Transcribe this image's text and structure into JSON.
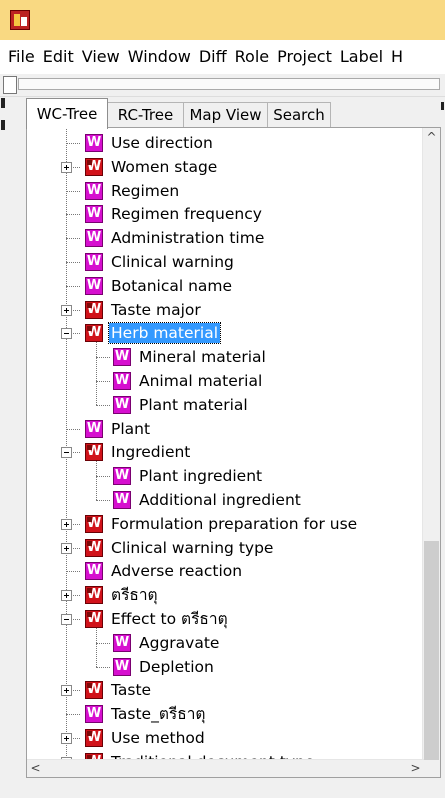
{
  "menu": [
    "File",
    "Edit",
    "View",
    "Window",
    "Diff",
    "Role",
    "Project",
    "Label",
    "H"
  ],
  "tabs": [
    {
      "label": "WC-Tree",
      "active": true
    },
    {
      "label": "RC-Tree",
      "active": false
    },
    {
      "label": "Map View",
      "active": false
    },
    {
      "label": "Search",
      "active": false
    }
  ],
  "tree": {
    "nodes": [
      {
        "label": "Use direction",
        "depth": 0,
        "icon": "pink",
        "expander": "none"
      },
      {
        "label": "Women stage",
        "depth": 0,
        "icon": "red",
        "expander": "plus"
      },
      {
        "label": "Regimen",
        "depth": 0,
        "icon": "pink",
        "expander": "none"
      },
      {
        "label": "Regimen frequency",
        "depth": 0,
        "icon": "pink",
        "expander": "none"
      },
      {
        "label": "Administration time",
        "depth": 0,
        "icon": "pink",
        "expander": "none"
      },
      {
        "label": "Clinical warning",
        "depth": 0,
        "icon": "pink",
        "expander": "none"
      },
      {
        "label": "Botanical name",
        "depth": 0,
        "icon": "pink",
        "expander": "none"
      },
      {
        "label": "Taste major",
        "depth": 0,
        "icon": "red",
        "expander": "plus"
      },
      {
        "label": "Herb material",
        "depth": 0,
        "icon": "red",
        "expander": "minus",
        "selected": true
      },
      {
        "label": "Mineral material",
        "depth": 1,
        "icon": "pink",
        "expander": "none"
      },
      {
        "label": "Animal material",
        "depth": 1,
        "icon": "pink",
        "expander": "none"
      },
      {
        "label": "Plant material",
        "depth": 1,
        "icon": "pink",
        "expander": "none"
      },
      {
        "label": "Plant",
        "depth": 0,
        "icon": "pink",
        "expander": "none"
      },
      {
        "label": "Ingredient",
        "depth": 0,
        "icon": "red",
        "expander": "minus"
      },
      {
        "label": "Plant ingredient",
        "depth": 1,
        "icon": "pink",
        "expander": "none"
      },
      {
        "label": "Additional ingredient",
        "depth": 1,
        "icon": "pink",
        "expander": "none"
      },
      {
        "label": "Formulation preparation for use",
        "depth": 0,
        "icon": "red",
        "expander": "plus"
      },
      {
        "label": "Clinical warning type",
        "depth": 0,
        "icon": "red",
        "expander": "plus"
      },
      {
        "label": "Adverse reaction",
        "depth": 0,
        "icon": "pink",
        "expander": "none"
      },
      {
        "label": "ตรีธาตุ",
        "depth": 0,
        "icon": "red",
        "expander": "plus"
      },
      {
        "label": "Effect to ตรีธาตุ",
        "depth": 0,
        "icon": "red",
        "expander": "minus"
      },
      {
        "label": "Aggravate",
        "depth": 1,
        "icon": "pink",
        "expander": "none"
      },
      {
        "label": "Depletion",
        "depth": 1,
        "icon": "pink",
        "expander": "none"
      },
      {
        "label": "Taste",
        "depth": 0,
        "icon": "red",
        "expander": "plus"
      },
      {
        "label": "Taste_ตรีธาตุ",
        "depth": 0,
        "icon": "pink",
        "expander": "none"
      },
      {
        "label": "Use method",
        "depth": 0,
        "icon": "red",
        "expander": "plus"
      },
      {
        "label": "Traditional document type",
        "depth": 0,
        "icon": "red",
        "expander": "plus"
      }
    ]
  },
  "icon_letter": "W",
  "scroll": {
    "up": "^",
    "left": "<",
    "right": ">"
  }
}
